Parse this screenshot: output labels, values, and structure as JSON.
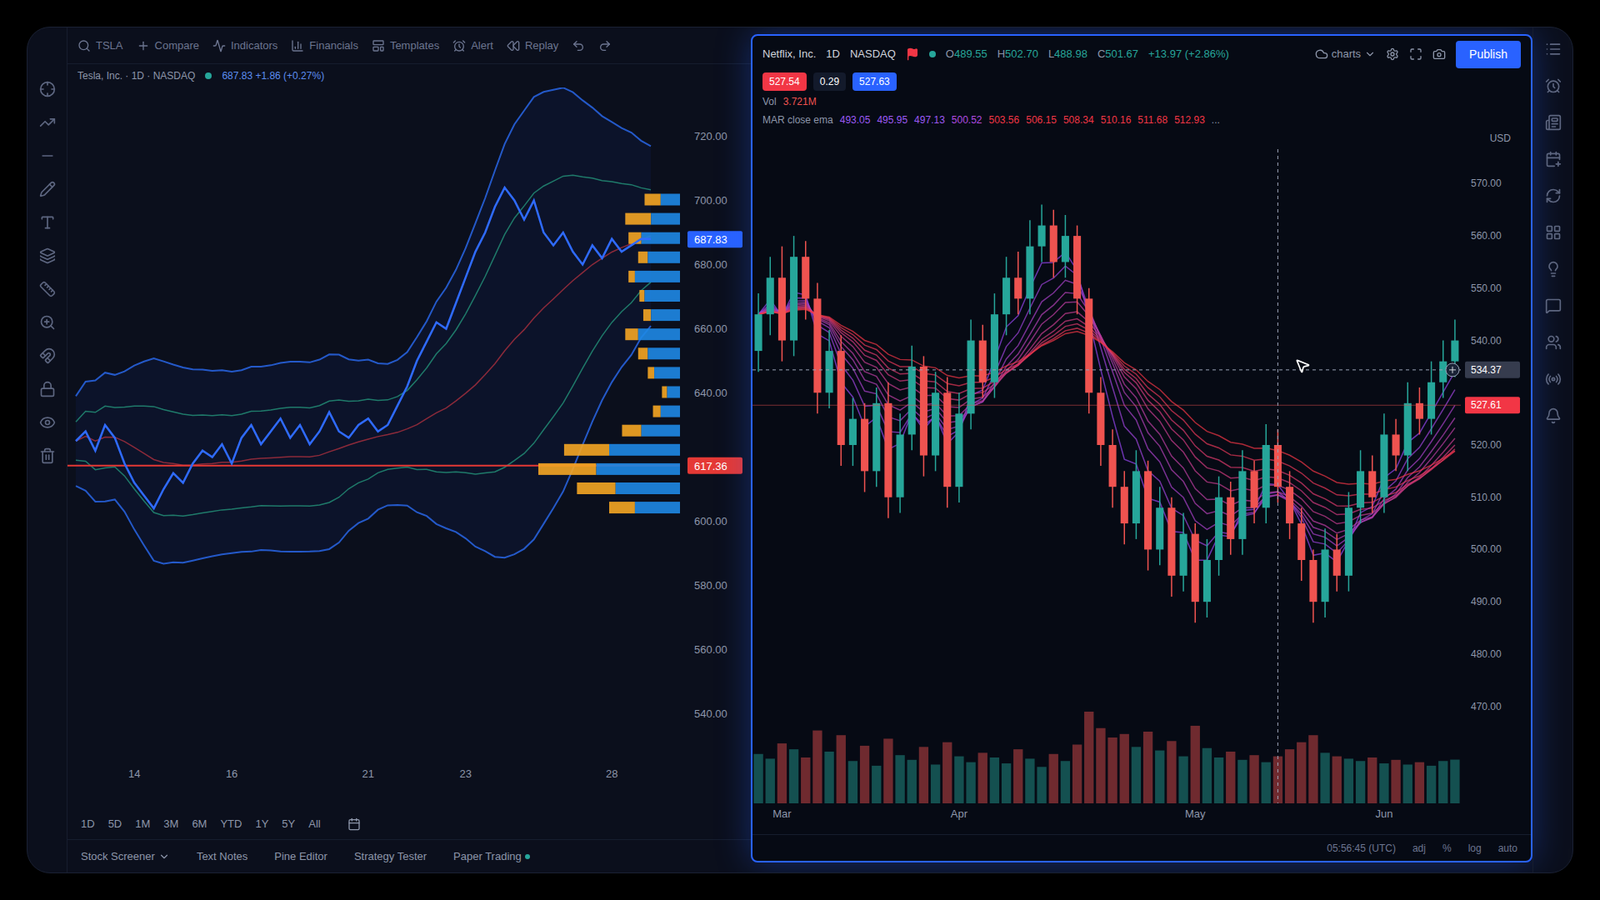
{
  "toolbar": {
    "symbol": "TSLA",
    "items": [
      "Compare",
      "Indicators",
      "Financials",
      "Templates",
      "Alert",
      "Replay"
    ]
  },
  "left_chart": {
    "title": "Tesla, Inc. · 1D · NASDAQ",
    "legend_values": "687.83 +1.86 (+0.27%)",
    "price_ticks": [
      "720.00",
      "700.00",
      "680.00",
      "660.00",
      "640.00",
      "600.00",
      "580.00",
      "560.00",
      "540.00"
    ],
    "date_ticks": [
      {
        "label": "14",
        "index": 6
      },
      {
        "label": "16",
        "index": 16
      },
      {
        "label": "21",
        "index": 30
      },
      {
        "label": "23",
        "index": 40
      },
      {
        "label": "28",
        "index": 55
      }
    ],
    "price": [
      625,
      628,
      622,
      630,
      626,
      618,
      612,
      608,
      604,
      610,
      615,
      612,
      618,
      622,
      620,
      624,
      618,
      626,
      630,
      624,
      628,
      632,
      626,
      630,
      624,
      628,
      634,
      628,
      626,
      630,
      632,
      628,
      630,
      636,
      642,
      650,
      656,
      662,
      660,
      668,
      676,
      684,
      690,
      698,
      704,
      700,
      694,
      700,
      690,
      686,
      690,
      684,
      680,
      686,
      682,
      688,
      684,
      686,
      688,
      688
    ],
    "last_price": "687.83",
    "poc_price": "617.36",
    "volume_profile": [
      {
        "price": 700,
        "buy": 30,
        "sell": 25
      },
      {
        "price": 694,
        "buy": 45,
        "sell": 40
      },
      {
        "price": 688,
        "buy": 60,
        "sell": 20
      },
      {
        "price": 682,
        "buy": 50,
        "sell": 15
      },
      {
        "price": 676,
        "buy": 70,
        "sell": 10
      },
      {
        "price": 670,
        "buy": 55,
        "sell": 8
      },
      {
        "price": 664,
        "buy": 45,
        "sell": 12
      },
      {
        "price": 658,
        "buy": 65,
        "sell": 20
      },
      {
        "price": 652,
        "buy": 50,
        "sell": 15
      },
      {
        "price": 646,
        "buy": 40,
        "sell": 10
      },
      {
        "price": 640,
        "buy": 20,
        "sell": 8
      },
      {
        "price": 634,
        "buy": 30,
        "sell": 12
      },
      {
        "price": 628,
        "buy": 60,
        "sell": 30
      },
      {
        "price": 622,
        "buy": 110,
        "sell": 70
      },
      {
        "price": 616,
        "buy": 130,
        "sell": 90
      },
      {
        "price": 610,
        "buy": 100,
        "sell": 60
      },
      {
        "price": 604,
        "buy": 70,
        "sell": 40
      }
    ]
  },
  "ranges": [
    {
      "label": "1D",
      "selected": false
    },
    {
      "label": "5D",
      "selected": false
    },
    {
      "label": "1M",
      "selected": false
    },
    {
      "label": "3M",
      "selected": false
    },
    {
      "label": "6M",
      "selected": false
    },
    {
      "label": "YTD",
      "selected": false
    },
    {
      "label": "1Y",
      "selected": false
    },
    {
      "label": "5Y",
      "selected": false
    },
    {
      "label": "All",
      "selected": false
    }
  ],
  "bottom_tabs": [
    {
      "label": "Stock Screener",
      "kind": "dropdown"
    },
    {
      "label": "Text Notes",
      "kind": "plain"
    },
    {
      "label": "Pine Editor",
      "kind": "plain"
    },
    {
      "label": "Strategy Tester",
      "kind": "plain"
    },
    {
      "label": "Paper Trading",
      "kind": "dot"
    }
  ],
  "right_chart": {
    "symbol": "Netflix, Inc.",
    "interval": "1D",
    "exchange": "NASDAQ",
    "ohlc": [
      {
        "key": "O",
        "value": "489.55"
      },
      {
        "key": "H",
        "value": "502.70"
      },
      {
        "key": "L",
        "value": "488.98"
      },
      {
        "key": "C",
        "value": "501.67"
      }
    ],
    "change": "+13.97 (+2.86%)",
    "badges": [
      {
        "text": "527.54",
        "color": "#f23645"
      },
      {
        "text": "0.29",
        "color": "#131a2b"
      },
      {
        "text": "527.63",
        "color": "#2962ff"
      }
    ],
    "volume_label": "Vol",
    "volume_value": "3.721M",
    "ema_title": "MAR close ema",
    "ema_values": [
      {
        "text": "493.05",
        "color": "#9b59f5"
      },
      {
        "text": "495.95",
        "color": "#9b59f5"
      },
      {
        "text": "497.13",
        "color": "#9b59f5"
      },
      {
        "text": "500.52",
        "color": "#b04ae0"
      },
      {
        "text": "503.56",
        "color": "#f23645"
      },
      {
        "text": "506.15",
        "color": "#f23645"
      },
      {
        "text": "508.34",
        "color": "#f23645"
      },
      {
        "text": "510.16",
        "color": "#f23645"
      },
      {
        "text": "511.68",
        "color": "#f23645"
      },
      {
        "text": "512.93",
        "color": "#f23645"
      },
      {
        "text": "...",
        "color": "#8d96aa"
      }
    ],
    "buttons": {
      "charts": "charts",
      "publish": "Publish"
    },
    "currency": "USD",
    "price_ticks": [
      "570.00",
      "560.00",
      "550.00",
      "540.00",
      "520.00",
      "510.00",
      "500.00",
      "490.00",
      "480.00",
      "470.00"
    ],
    "crosshair": {
      "price": "534.37",
      "index": 44
    },
    "last_price": "527.61",
    "months": [
      {
        "label": "Mar",
        "index": 2
      },
      {
        "label": "Apr",
        "index": 17
      },
      {
        "label": "May",
        "index": 37
      },
      {
        "label": "Jun",
        "index": 53
      }
    ],
    "candles": {
      "open": [
        538,
        545,
        552,
        540,
        556,
        548,
        530,
        538,
        520,
        525,
        515,
        528,
        510,
        522,
        535,
        518,
        530,
        512,
        526,
        540,
        532,
        545,
        552,
        548,
        558,
        562,
        555,
        560,
        548,
        530,
        520,
        512,
        505,
        515,
        500,
        508,
        495,
        503,
        490,
        498,
        510,
        502,
        515,
        508,
        520,
        512,
        505,
        498,
        490,
        500,
        495,
        508,
        515,
        510,
        522,
        518,
        528,
        525,
        532,
        536
      ],
      "high": [
        549,
        556,
        558,
        560,
        559,
        551,
        542,
        541,
        529,
        528,
        531,
        532,
        526,
        539,
        537,
        534,
        533,
        530,
        544,
        543,
        549,
        556,
        557,
        563,
        566,
        565,
        564,
        562,
        550,
        533,
        523,
        515,
        519,
        517,
        512,
        510,
        507,
        505,
        502,
        514,
        513,
        519,
        517,
        524,
        523,
        515,
        508,
        500,
        504,
        503,
        511,
        519,
        518,
        526,
        525,
        532,
        531,
        536,
        540,
        544
      ],
      "low": [
        534,
        541,
        536,
        537,
        544,
        526,
        527,
        516,
        516,
        511,
        512,
        506,
        507,
        519,
        514,
        515,
        508,
        509,
        523,
        529,
        529,
        541,
        545,
        545,
        555,
        552,
        552,
        545,
        526,
        516,
        508,
        501,
        502,
        496,
        497,
        491,
        492,
        486,
        487,
        495,
        499,
        499,
        505,
        505,
        509,
        502,
        494,
        486,
        487,
        492,
        492,
        505,
        507,
        507,
        515,
        515,
        522,
        522,
        529,
        533
      ],
      "close": [
        545,
        552,
        540,
        556,
        548,
        530,
        538,
        520,
        525,
        515,
        528,
        510,
        522,
        535,
        518,
        530,
        512,
        526,
        540,
        532,
        545,
        552,
        548,
        558,
        562,
        555,
        560,
        548,
        530,
        520,
        512,
        505,
        515,
        500,
        508,
        495,
        503,
        490,
        498,
        510,
        502,
        515,
        508,
        520,
        512,
        505,
        498,
        490,
        500,
        495,
        508,
        515,
        510,
        522,
        518,
        528,
        525,
        532,
        536,
        540
      ]
    },
    "volume": [
      4.2,
      3.8,
      5.1,
      4.6,
      3.9,
      6.2,
      4.4,
      5.8,
      3.6,
      4.9,
      3.2,
      5.5,
      4.1,
      3.7,
      4.8,
      3.3,
      5.2,
      4.0,
      3.5,
      4.3,
      3.9,
      3.4,
      4.6,
      3.8,
      3.1,
      4.2,
      3.6,
      5.0,
      7.8,
      6.4,
      5.6,
      5.9,
      4.8,
      6.1,
      4.5,
      5.3,
      4.0,
      6.6,
      4.7,
      3.9,
      4.4,
      3.7,
      4.1,
      3.5,
      4.0,
      4.6,
      5.2,
      5.8,
      4.3,
      4.0,
      3.8,
      3.6,
      3.9,
      3.4,
      3.7,
      3.3,
      3.5,
      3.2,
      3.6,
      3.72
    ],
    "status": {
      "time": "05:56:45 (UTC)",
      "toggles": [
        "adj",
        "%",
        "log",
        "auto"
      ]
    }
  }
}
